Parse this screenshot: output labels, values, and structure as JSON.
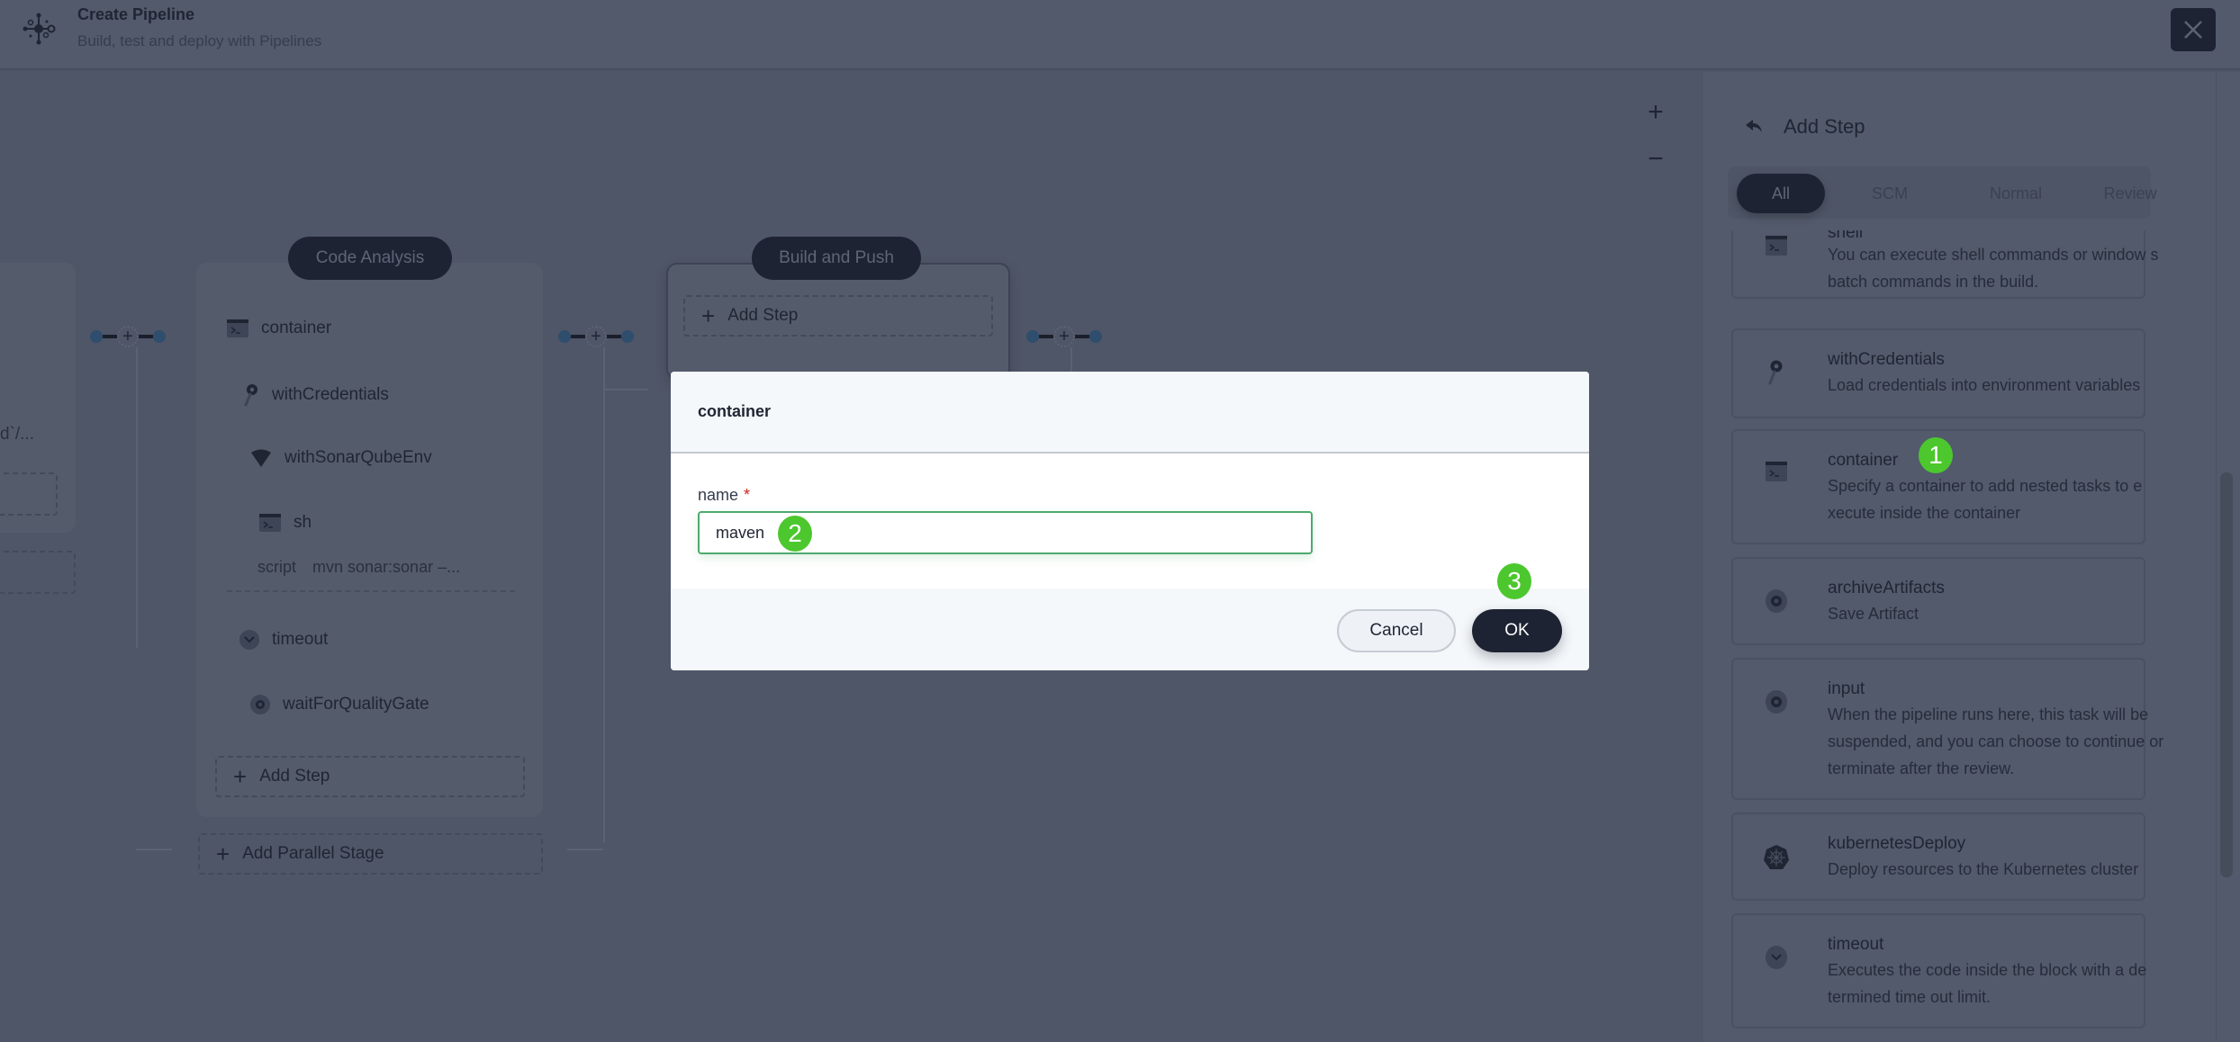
{
  "header": {
    "title": "Create Pipeline",
    "subtitle": "Build, test and deploy with Pipelines",
    "logo_icon": "pipeline-icon",
    "close_icon": "close-icon"
  },
  "canvas": {
    "zoom_in": "+",
    "zoom_out": "−",
    "partial_stage": {
      "truncated_text": "d`/..."
    },
    "stages": [
      {
        "name": "Code Analysis",
        "steps": [
          {
            "icon": "terminal-icon",
            "label": "container"
          },
          {
            "icon": "key-icon",
            "label": "withCredentials"
          },
          {
            "icon": "sonarqube-icon",
            "label": "withSonarQubeEnv"
          },
          {
            "icon": "terminal-icon",
            "label": "sh"
          },
          {
            "icon": "chevron-circle-icon",
            "label": "timeout"
          },
          {
            "icon": "circle-dot-icon",
            "label": "waitForQualityGate"
          }
        ],
        "sh_param_key": "script",
        "sh_param_value": "mvn sonar:sonar –...",
        "add_step": "Add Step",
        "add_parallel_stage": "Add Parallel Stage"
      },
      {
        "name": "Build and Push",
        "add_step": "Add Step"
      }
    ]
  },
  "sidebar": {
    "back_icon": "back-arrow-icon",
    "title": "Add Step",
    "tabs": [
      {
        "label": "All",
        "active": true
      },
      {
        "label": "SCM",
        "active": false
      },
      {
        "label": "Normal",
        "active": false
      },
      {
        "label": "Review",
        "active": false
      }
    ],
    "items": [
      {
        "icon": "terminal-icon",
        "name": "shell",
        "description": "You can execute shell commands or window s batch commands in the build."
      },
      {
        "icon": "key-icon",
        "name": "withCredentials",
        "description": "Load credentials into environment variables"
      },
      {
        "icon": "terminal-icon",
        "name": "container",
        "description": "Specify a container to add nested tasks to e xecute inside the container"
      },
      {
        "icon": "circle-dot-icon",
        "name": "archiveArtifacts",
        "description": "Save Artifact"
      },
      {
        "icon": "circle-dot-icon",
        "name": "input",
        "description": "When the pipeline runs here, this task will be suspended, and you can choose to continue or terminate after the review."
      },
      {
        "icon": "kubernetes-icon",
        "name": "kubernetesDeploy",
        "description": "Deploy resources to the Kubernetes cluster"
      },
      {
        "icon": "chevron-circle-icon",
        "name": "timeout",
        "description": "Executes the code inside the block with a de termined time out limit."
      }
    ]
  },
  "modal": {
    "title": "container",
    "field_label": "name",
    "required_mark": "*",
    "field_value": "maven",
    "cancel_label": "Cancel",
    "ok_label": "OK"
  },
  "annotations": {
    "badge1": "1",
    "badge2": "2",
    "badge3": "3",
    "badge_color": "#4cc72e"
  },
  "colors": {
    "overlay": "#4f5667",
    "primary_dark": "#1e2333",
    "input_focus": "#4eaa6e",
    "required": "#ca2621"
  }
}
